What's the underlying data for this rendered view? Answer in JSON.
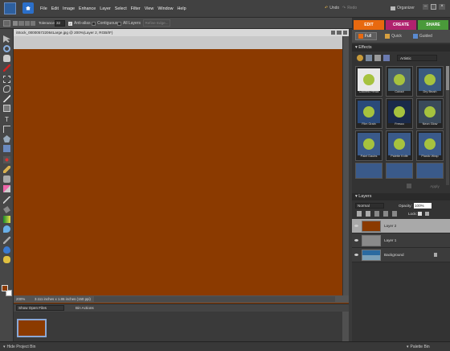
{
  "menubar": {
    "items": [
      "File",
      "Edit",
      "Image",
      "Enhance",
      "Layer",
      "Select",
      "Filter",
      "View",
      "Window",
      "Help"
    ],
    "undo": "Undo",
    "redo": "Redo",
    "organizer": "Organizer"
  },
  "options": {
    "tolerance_label": "Tolerance:",
    "tolerance_value": "32",
    "antialias": "Anti-alias",
    "contiguous": "Contiguous",
    "all_layers": "All Layers",
    "refine": "Refine Edge..."
  },
  "document": {
    "title": "iStock_000005722064Large.jpg @ 200%(Layer 2, RGB/8*)",
    "zoom": "200%",
    "size": "3.111 inches x 1.86 inches (150 ppi)"
  },
  "bin": {
    "dropdown": "Show Open Files",
    "actions": "Bin Actions"
  },
  "bottom": {
    "hide_bin": "Hide Project Bin",
    "palette_bin": "Palette Bin"
  },
  "tabs": {
    "edit": "EDIT",
    "create": "CREATE",
    "share": "SHARE",
    "full": "Full",
    "quick": "Quick",
    "guided": "Guided"
  },
  "colors": {
    "edit": "#e8690f",
    "create": "#b0226e",
    "share": "#4a9a3a",
    "canvas": "#8b3a00"
  },
  "effects": {
    "header": "Effects",
    "category": "Artistic",
    "apply": "Apply",
    "items": [
      "Colored Pencil",
      "Cutout",
      "Dry Brush",
      "Film Grain",
      "Fresco",
      "Neon Glow",
      "Paint Daubs",
      "Palette Knife",
      "Plastic Wrap"
    ]
  },
  "layers": {
    "header": "Layers",
    "blend": "Normal",
    "opacity_label": "Opacity:",
    "opacity_value": "100%",
    "lock_label": "Lock:",
    "items": [
      "Layer 2",
      "Layer 1",
      "Background"
    ]
  }
}
